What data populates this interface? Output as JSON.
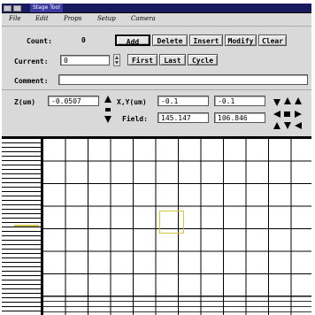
{
  "window": {
    "title": "Stage Tool"
  },
  "menu": [
    "File",
    "Edit",
    "Props",
    "Setup",
    "Camera"
  ],
  "count": {
    "label": "Count:",
    "value": "0"
  },
  "buttons_row1": [
    "Add",
    "Delete",
    "Insert",
    "Modify",
    "Clear"
  ],
  "current": {
    "label": "Current:",
    "value": "0"
  },
  "buttons_row2": [
    "First",
    "Last",
    "Cycle"
  ],
  "comment": {
    "label": "Comment:",
    "value": ""
  },
  "z": {
    "label": "Z(um)",
    "value": "-0.0507"
  },
  "xy": {
    "label": "X,Y(um)",
    "x": "-0.1",
    "y": "-0.1"
  },
  "field": {
    "label": "Field:",
    "w": "145.147",
    "h": "106.846"
  },
  "colors": {
    "title_bar": "#1a1a5e",
    "window_bg": "#d9d9d9",
    "grid_line": "#000000",
    "marker": "#d8c640"
  }
}
